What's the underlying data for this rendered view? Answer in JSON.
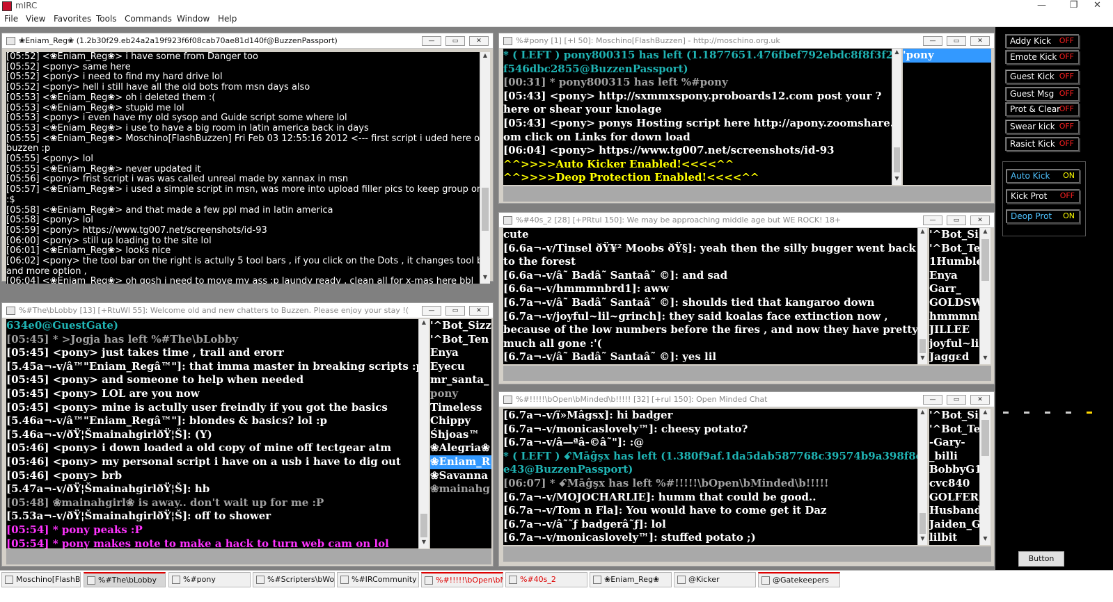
{
  "app": {
    "title": "mIRC",
    "minimize": "—",
    "restore": "❐",
    "close": "✕"
  },
  "menu": [
    "File",
    "View",
    "Favorites",
    "Tools",
    "Commands",
    "Window",
    "Help"
  ],
  "windows": {
    "query": {
      "title": "❀Eniam_Reg❀ (1.2b30f29.eb24a2a19f923f6f08cab70ae81d140f@BuzzenPassport)",
      "lines": [
        {
          "t": "[05:52] <❀Eniam_Reg❀> i have some from Danger too",
          "c": "t"
        },
        {
          "t": "[05:52] <pony> same here",
          "c": "t"
        },
        {
          "t": "[05:52] <pony> i need to find my hard drive lol",
          "c": "t"
        },
        {
          "t": "[05:52] <pony> hell i still have all the old bots from msn days also",
          "c": "t"
        },
        {
          "t": "[05:53] <❀Eniam_Reg❀> oh i deleted them :(",
          "c": "t"
        },
        {
          "t": "[05:53] <❀Eniam_Reg❀> stupid me lol",
          "c": "t"
        },
        {
          "t": "[05:53] <pony> i even have my old sysop and Guide script some where lol",
          "c": "t"
        },
        {
          "t": "[05:53] <❀Eniam_Reg❀> i use to have a big room in latin america back in days",
          "c": "t"
        },
        {
          "t": "[05:55] <❀Eniam_Reg❀> Moschino[FlashBuzzen] Fri Feb 03 12:55:16 2012 <--- first script i uded here on",
          "c": "t"
        },
        {
          "t": " buzzen :p",
          "c": "t"
        },
        {
          "t": "[05:55] <pony> lol",
          "c": "t"
        },
        {
          "t": "[05:55] <❀Eniam_Reg❀> never updated it",
          "c": "t"
        },
        {
          "t": "[05:56] <pony> frist script i was was called unreal made by xannax in msn",
          "c": "t"
        },
        {
          "t": "[05:57] <❀Eniam_Reg❀> i used a simple script in msn, was more into upload filler pics to keep group on top",
          "c": "t"
        },
        {
          "t": " :$",
          "c": "t"
        },
        {
          "t": "[05:58] <❀Eniam_Reg❀> and that made a few ppl mad in latin america",
          "c": "t"
        },
        {
          "t": "[05:58] <pony> lol",
          "c": "t"
        },
        {
          "t": "[05:59] <pony> https://www.tg007.net/screenshots/id-93",
          "c": "t"
        },
        {
          "t": "[06:00] <pony> still up loading to the site lol",
          "c": "t"
        },
        {
          "t": "[06:01] <❀Eniam_Reg❀> looks nice",
          "c": "t"
        },
        {
          "t": "[06:02] <pony> the tool bar on the right is actully 5 tool bars , if you click on the Dots , it changes tool bar",
          "c": "t"
        },
        {
          "t": "and more option ,",
          "c": "t"
        },
        {
          "t": "[06:04] <❀Eniam_Reg❀> oh gosh i need to move my ass :p laundy ready , clean all for x-mas here bbl",
          "c": "t"
        }
      ]
    },
    "lobby": {
      "title": "%#The\\bLobby [13] [+RtuWl 55]: Welcome old and new chatters to Buzzen. Please enjoy your stay !(f)",
      "lines": [
        {
          "t": "634e0@GuestGate)",
          "c": "c"
        },
        {
          "t": "[05:45] * >Jogja has left %#The\\bLobby",
          "c": "g"
        },
        {
          "t": "[05:45] <pony> just takes time , trail and erorr",
          "c": "t"
        },
        {
          "t": "[5.45a¬-v/â™\"Eniam_Regâ™\"]: that imma master in breaking scripts :p",
          "c": "t"
        },
        {
          "t": "[05:45] <pony> and someone to help when needed",
          "c": "t"
        },
        {
          "t": "[05:45] <pony> LOL are you now",
          "c": "t"
        },
        {
          "t": "[05:45] <pony> mine is actully user freindly if you got the basics",
          "c": "t"
        },
        {
          "t": "[5.46a¬-v/â™\"Eniam_Regâ™\"]: blondes & basics? lol :p",
          "c": "t"
        },
        {
          "t": "[5.46a¬-v/ðŸ¦ŠmainahgirlðŸ¦Š]: (Y)",
          "c": "t"
        },
        {
          "t": "[05:46] <pony> i down loaded a old copy of mine off tectgear atm",
          "c": "t"
        },
        {
          "t": "[05:46] <pony> my personal script i have on a usb i have to dig out",
          "c": "t"
        },
        {
          "t": "[05:46] <pony> brb",
          "c": "t"
        },
        {
          "t": "[5.47a¬-v/ðŸ¦ŠmainahgirlðŸ¦Š]: hb",
          "c": "t"
        },
        {
          "t": "[05:48] ❀mainahgirl❀ is away.. don't wait up for me :P",
          "c": "g"
        },
        {
          "t": "[5.53a¬-v/ðŸ¦ŠmainahgirlðŸ¦Š]: off to shower",
          "c": "t"
        },
        {
          "t": "[05:54] * pony peaks :P",
          "c": "m"
        },
        {
          "t": "[05:54] * pony makes note to make a hack to turn web cam on lol",
          "c": "m"
        }
      ],
      "nicks": [
        "'^Bot_Sizz",
        "'^Bot_Ten",
        "Enya",
        "Eyecu",
        "mr_santa_",
        "pony",
        "Timeless",
        "Chippy",
        "Śhjoas™",
        "❀Alegria❀",
        "❀Eniam_R",
        "❀Savanna",
        "❀mainahg"
      ]
    },
    "pony": {
      "title": "%#pony [1] [+l 50]: Moschino[FlashBuzzen] - http://moschino.org.uk",
      "lines": [
        {
          "t": "* ( LEFT ) pony800315 has left (1.1877651.476fbef792ebdc8f8f3f2f",
          "c": "c"
        },
        {
          "t": "f546dbc2855@BuzzenPassport)",
          "c": "c"
        },
        {
          "t": "[00:31] * pony800315 has left %#pony",
          "c": "g"
        },
        {
          "t": "[05:43] <pony> http://sxmmxspony.proboards12.com post your ?",
          "c": "t"
        },
        {
          "t": "here or shear your knolage",
          "c": "t"
        },
        {
          "t": "[05:43] <pony> ponys Hosting script here http://apony.zoomshare.c",
          "c": "t"
        },
        {
          "t": "om click on Links for down load",
          "c": "t"
        },
        {
          "t": "[06:04] <pony> https://www.tg007.net/screenshots/id-93",
          "c": "t"
        },
        {
          "t": "^^>>>>Auto Kicker Enabled!<<<<^^",
          "c": "y"
        },
        {
          "t": "^^>>>>Deop Protection Enabled!<<<<^^",
          "c": "y"
        }
      ],
      "nicks": [
        "'pony"
      ]
    },
    "forties": {
      "title": "%#40s_2 [28] [+PRtul 150]: We may be approaching middle age but WE ROCK! 18+",
      "lines": [
        {
          "t": "cute",
          "c": "t"
        },
        {
          "t": "[6.6a¬-v/Tinsel ðŸ¥² Moobs ðŸ§]: yeah then the silly bugger went back",
          "c": "t"
        },
        {
          "t": "to the forest",
          "c": "t"
        },
        {
          "t": "[6.6a¬-v/â˜ Badâ˜ Santaâ˜ ©]: and sad",
          "c": "t"
        },
        {
          "t": "[6.6a¬-v/hmmmnbrd1]: aww",
          "c": "t"
        },
        {
          "t": "[6.7a¬-v/â˜ Badâ˜ Santaâ˜ ©]: shoulds tied that kangaroo down",
          "c": "t"
        },
        {
          "t": "[6.7a¬-v/joyful~lil~grinch]: they said koalas face extinction now ,",
          "c": "t"
        },
        {
          "t": "because of the low numbers before the fires , and now they have pretty",
          "c": "t"
        },
        {
          "t": "much all gone :'(",
          "c": "t"
        },
        {
          "t": "[6.7a¬-v/â˜ Badâ˜ Santaâ˜ ©]: yes lil",
          "c": "t"
        }
      ],
      "nicks": [
        "'^Bot_Si",
        "'^Bot_Te",
        "1Humble",
        "Enya",
        "Garr_",
        "GOLDSW",
        "hmmmnb",
        "JILLEE",
        "joyful~li",
        "Jaggɛd"
      ]
    },
    "openminded": {
      "title": "%#!!!!!\\bOpen\\bMinded\\b!!!!! [32] [+rul 150]: Open Minded Chat",
      "lines": [
        {
          "t": "[6.7a¬-v/ï»Mâgsx]: hi badger",
          "c": "t"
        },
        {
          "t": "[6.7a¬-v/monicaslovely™]: cheesy potato?",
          "c": "t"
        },
        {
          "t": "[6.7a¬-v/â—ªâ-©â˜\"]: :@",
          "c": "t"
        },
        {
          "t": "* ( LEFT ) ꗃMāĝşx has left (1.380f9af.1da5dab587768c39574b9a398f8de",
          "c": "c"
        },
        {
          "t": "e43@BuzzenPassport)",
          "c": "c"
        },
        {
          "t": "[06:07] * ꗃMāĝşx has left %#!!!!!\\bOpen\\bMinded\\b!!!!!",
          "c": "g"
        },
        {
          "t": "[6.7a¬-v/MOJOCHARLIE]: humm that could be good..",
          "c": "t"
        },
        {
          "t": "[6.7a¬-v/Tom n Fla]: You would have to come get it Daz",
          "c": "t"
        },
        {
          "t": "[6.7a¬-v/â˜˜ƒ badgerâ˜ƒ]: lol",
          "c": "t"
        },
        {
          "t": "[6.7a¬-v/monicaslovely™]: stuffed potato ;)",
          "c": "t"
        }
      ],
      "nicks": [
        "'^Bot_Si",
        "'^Bot_Te",
        "-Gary-",
        "_billi",
        "BobbyG1",
        "cvc840",
        "GOLFER1",
        "Husband",
        "Jaiden_G",
        "lilbit"
      ]
    }
  },
  "toolbar": {
    "group1": [
      {
        "label": "Addy Kick",
        "state": "OFF"
      },
      {
        "label": "Emote Kick",
        "state": "OFF"
      },
      {
        "label": "Guest Kick",
        "state": "OFF"
      },
      {
        "label": "Guest Msg",
        "state": "OFF"
      },
      {
        "label": "Prot & Clear",
        "state": "OFF"
      },
      {
        "label": "Swear kick",
        "state": "OFF"
      },
      {
        "label": "Rasict Kick",
        "state": "OFF"
      }
    ],
    "group2": [
      {
        "label": "Auto Kick",
        "state": "ON"
      },
      {
        "label": "Kick Prot",
        "state": "OFF"
      },
      {
        "label": "Deop Prot",
        "state": "ON"
      }
    ],
    "button_label": "Button"
  },
  "taskbar": [
    "Moschino[FlashBu...",
    "%#The\\bLobby",
    "%#pony",
    "%#Scripters\\bWorld",
    "%#IRCommunity",
    "%#!!!!!\\bOpen\\bM...",
    "%#40s_2",
    "❀Eniam_Reg❀",
    "@Kicker",
    "@Gatekeepers"
  ],
  "colors": {
    "text": "#ffffff",
    "join_leave": "#a0a0a0",
    "cyan": "#1fb3b3",
    "yellow": "#ffff00",
    "magenta": "#ff33ff",
    "red": "#ff2020",
    "selected": "#3399ff"
  }
}
